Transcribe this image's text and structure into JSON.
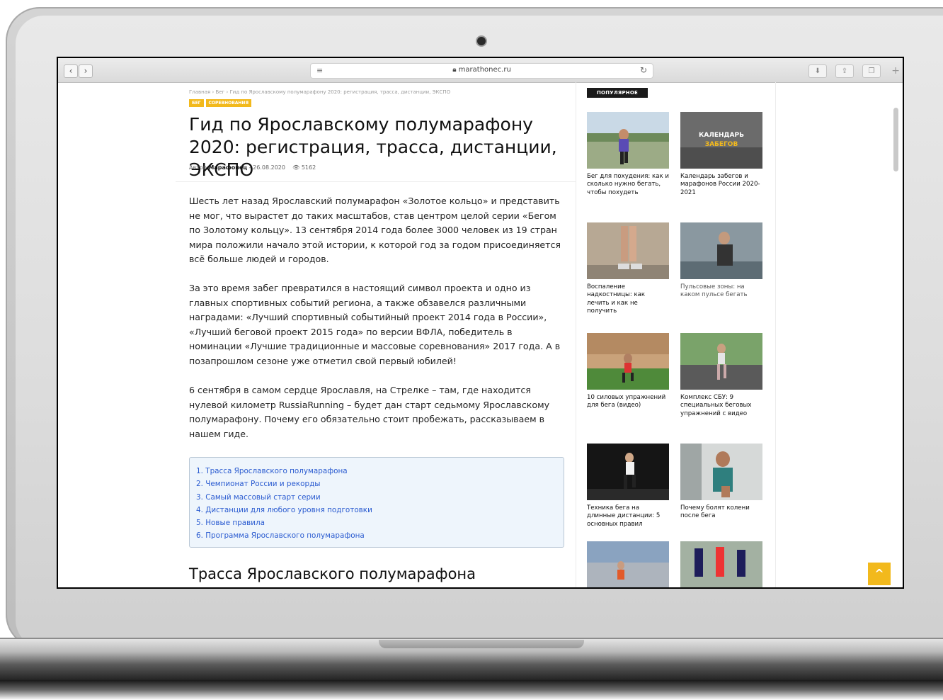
{
  "browser": {
    "url": "marathonec.ru",
    "back_icon": "‹",
    "forward_icon": "›",
    "reload_icon": "↻"
  },
  "breadcrumb": "Главная  ›  Бег  ›  Гид по Ярославскому полумарафону 2020: регистрация, трасса, дистанции, ЭКСПО",
  "tags": [
    "БЕГ",
    "СОРЕВНОВАНИЯ"
  ],
  "title": "Гид по Ярославскому полумарафону 2020: регистрация, трасса, дистанции, ЭКСПО",
  "meta": {
    "author_prefix": "Автор ",
    "author": "Марафонец",
    "date": " - 26.08.2020",
    "views": "5162"
  },
  "paragraphs": [
    "Шесть лет назад Ярославский полумарафон «Золотое кольцо» и представить не мог, что вырастет до таких масштабов, став центром целой серии «Бегом по Золотому кольцу». 13 сентября 2014 года более 3000 человек из 19 стран мира положили начало этой истории, к которой год за годом присоединяется всё больше людей и городов.",
    "За это время забег превратился в настоящий символ проекта и одно из главных спортивных событий региона, а также обзавелся различными наградами: «Лучший спортивный событийный проект 2014 года в России», «Лучший беговой проект 2015 года» по версии ВФЛА, победитель в номинации «Лучшие традиционные и массовые соревнования» 2017 года. А в позапрошлом сезоне уже отметил свой первый юбилей!",
    "6 сентября в самом сердце Ярославля, на Стрелке – там, где находится нулевой километр RussiaRunning – будет дан старт седьмому Ярославскому полумарафону. Почему его обязательно стоит пробежать, рассказываем в нашем гиде."
  ],
  "toc": [
    "1. Трасса Ярославского полумарафона",
    "2. Чемпионат России и рекорды",
    "3. Самый массовый старт серии",
    "4. Дистанции для любого уровня подготовки",
    "5. Новые правила",
    "6. Программа Ярославского полумарафона"
  ],
  "section_heading": "Трасса Ярославского полумарафона",
  "sidebar": {
    "heading": "ПОПУЛЯРНОЕ",
    "calendar_overlay": [
      "КАЛЕНДАРЬ",
      "ЗАБЕГОВ"
    ],
    "cards": [
      {
        "caption": "Бег для похудения: как и сколько нужно бегать, чтобы похудеть"
      },
      {
        "caption": "Календарь забегов и марафонов России 2020-2021"
      },
      {
        "caption": "Воспаление надкостницы: как лечить и как не получить"
      },
      {
        "caption": "Пульсовые зоны: на каком пульсе бегать"
      },
      {
        "caption": "10 силовых упражнений для бега (видео)"
      },
      {
        "caption": "Комплекс СБУ: 9 специальных беговых упражнений с видео"
      },
      {
        "caption": "Техника бега на длинные дистанции: 5 основных правил"
      },
      {
        "caption": "Почему болят колени после бега"
      },
      {
        "caption": ""
      },
      {
        "caption": ""
      }
    ]
  },
  "scroll_top_icon": "^",
  "colors": {
    "accent": "#f2b91c",
    "link": "#2a5bd0",
    "toc_bg": "#eef5fc"
  }
}
